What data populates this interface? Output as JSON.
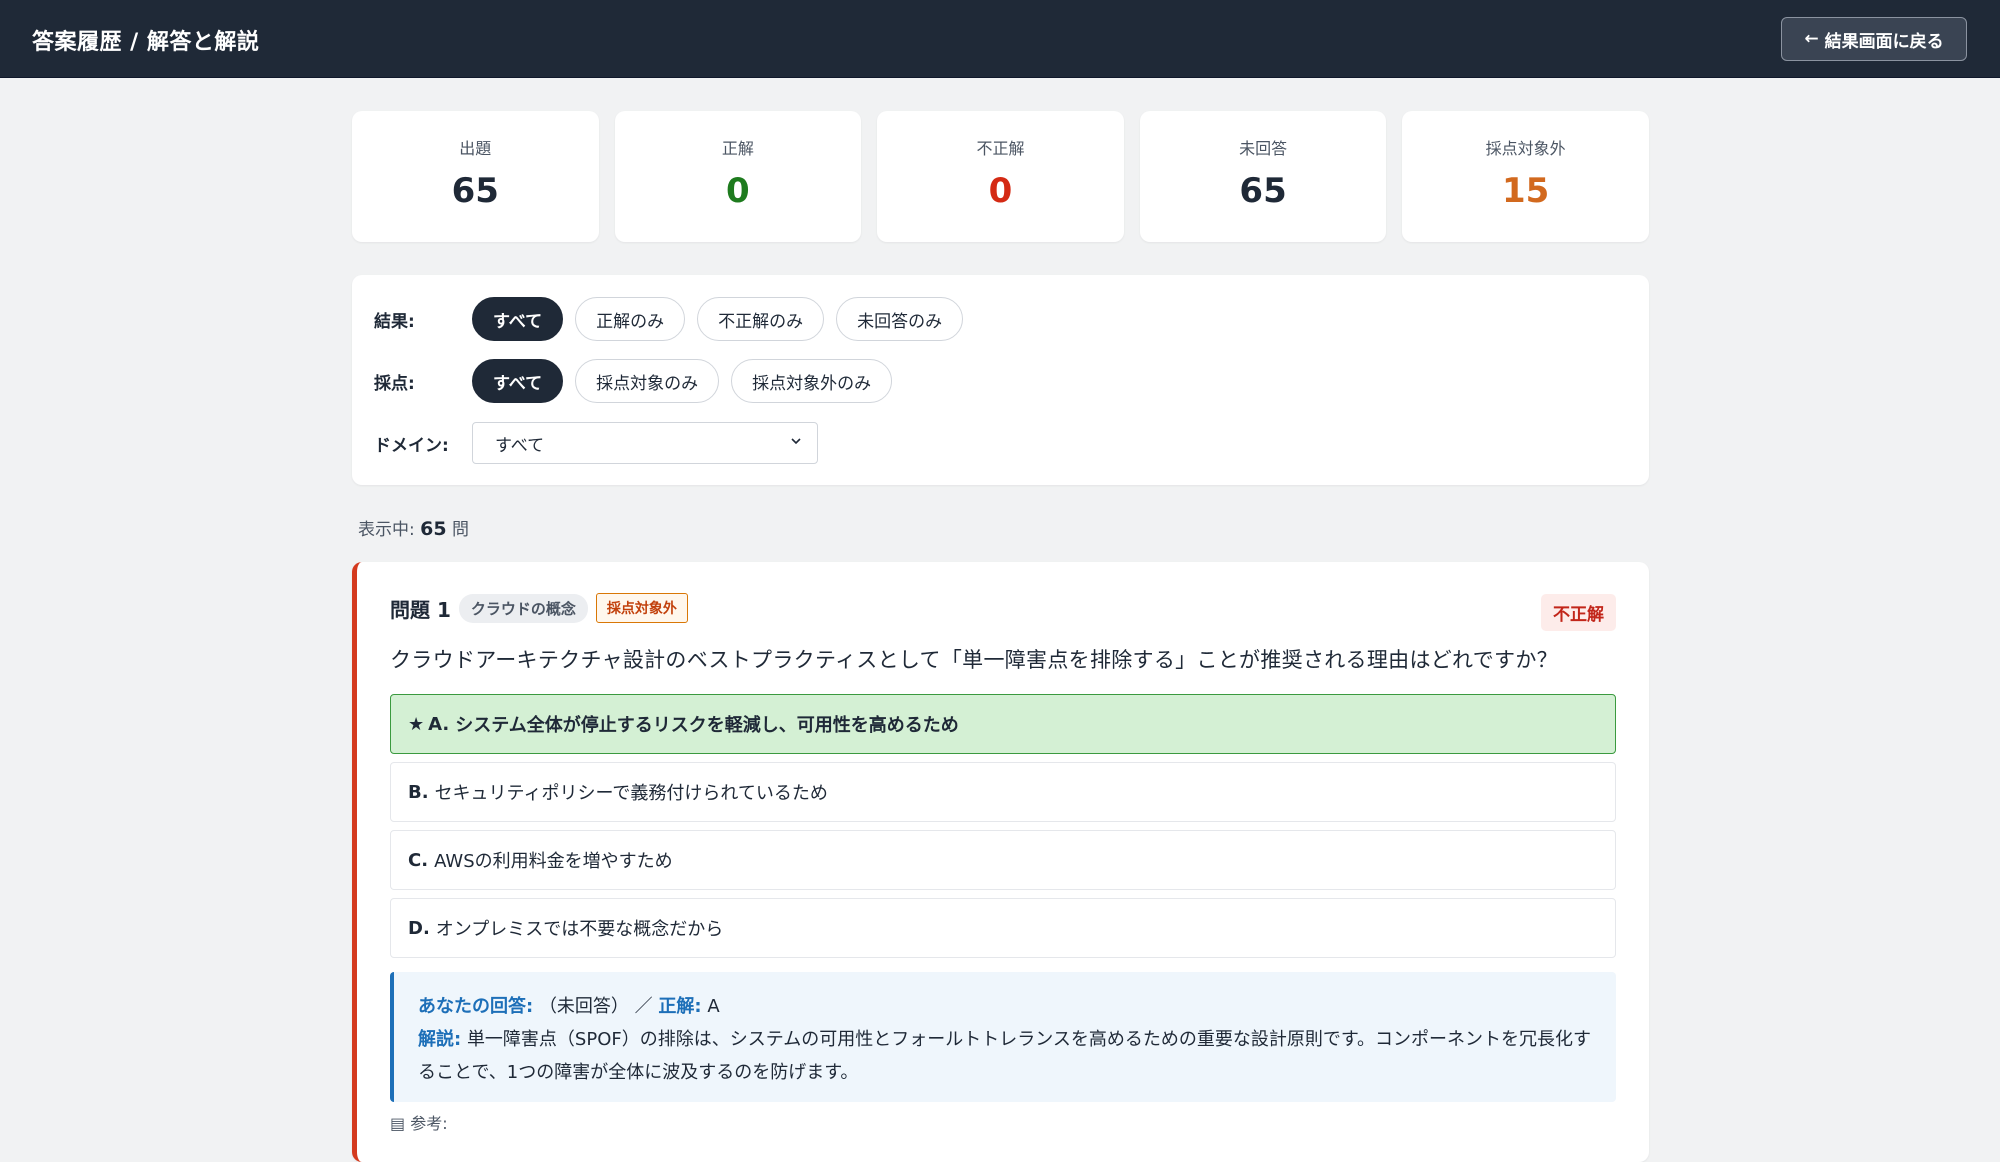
{
  "header": {
    "title": "答案履歴 / 解答と解説",
    "back_label": "結果画面に戻る",
    "back_arrow": "←"
  },
  "stats": [
    {
      "label": "出題",
      "value": "65",
      "color": "#1f2937"
    },
    {
      "label": "正解",
      "value": "0",
      "color": "#1e7b1e"
    },
    {
      "label": "不正解",
      "value": "0",
      "color": "#d42a14"
    },
    {
      "label": "未回答",
      "value": "65",
      "color": "#1f2937"
    },
    {
      "label": "採点対象外",
      "value": "15",
      "color": "#d2691e"
    }
  ],
  "filters": {
    "result": {
      "label": "結果:",
      "options": [
        "すべて",
        "正解のみ",
        "不正解のみ",
        "未回答のみ"
      ],
      "selected": "すべて"
    },
    "scoring": {
      "label": "採点:",
      "options": [
        "すべて",
        "採点対象のみ",
        "採点対象外のみ"
      ],
      "selected": "すべて"
    },
    "domain": {
      "label": "ドメイン:",
      "selected": "すべて"
    }
  },
  "count": {
    "prefix": "表示中:",
    "value": "65",
    "suffix": "問"
  },
  "question": {
    "number": "問題 1",
    "domain_tag": "クラウドの概念",
    "excluded_tag": "採点対象外",
    "verdict": "不正解",
    "text": "クラウドアーキテクチャ設計のベストプラクティスとして「単一障害点を排除する」ことが推奨される理由はどれですか？",
    "choices": [
      {
        "letter": "A.",
        "text": "システム全体が停止するリスクを軽減し、可用性を高めるため",
        "correct": true
      },
      {
        "letter": "B.",
        "text": "セキュリティポリシーで義務付けられているため",
        "correct": false
      },
      {
        "letter": "C.",
        "text": "AWSの利用料金を増やすため",
        "correct": false
      },
      {
        "letter": "D.",
        "text": "オンプレミスでは不要な概念だから",
        "correct": false
      }
    ],
    "your_answer_label": "あなたの回答:",
    "your_answer_value": "（未回答）",
    "separator": "／",
    "correct_label": "正解:",
    "correct_value": "A",
    "explanation_label": "解説:",
    "explanation_text": "単一障害点（SPOF）の排除は、システムの可用性とフォールトトレランスを高めるための重要な設計原則です。コンポーネントを冗長化することで、1つの障害が全体に波及するのを防げます。",
    "reference_label": "参考:"
  }
}
